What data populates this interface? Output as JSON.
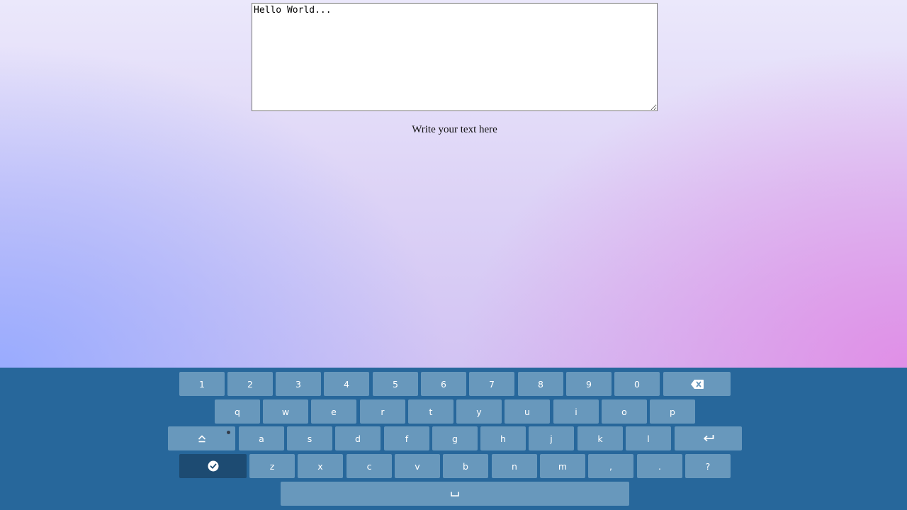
{
  "editor": {
    "value": "Hello World..."
  },
  "caption": "Write your text here",
  "keyboard": {
    "row1": [
      "1",
      "2",
      "3",
      "4",
      "5",
      "6",
      "7",
      "8",
      "9",
      "0"
    ],
    "row2": [
      "q",
      "w",
      "e",
      "r",
      "t",
      "y",
      "u",
      "i",
      "o",
      "p"
    ],
    "row3": [
      "a",
      "s",
      "d",
      "f",
      "g",
      "h",
      "j",
      "k",
      "l"
    ],
    "row4": [
      "z",
      "x",
      "c",
      "v",
      "b",
      "n",
      "m",
      ",",
      ".",
      "?"
    ],
    "icons": {
      "backspace": "backspace-icon",
      "shift": "shift-icon",
      "enter": "enter-icon",
      "accept": "check-icon",
      "space": "space-icon"
    }
  },
  "colors": {
    "keyboard_bg": "#27679b",
    "key_bg": "#6898bc",
    "accept_key_bg": "#1d4b72",
    "key_text": "#ffffff"
  }
}
